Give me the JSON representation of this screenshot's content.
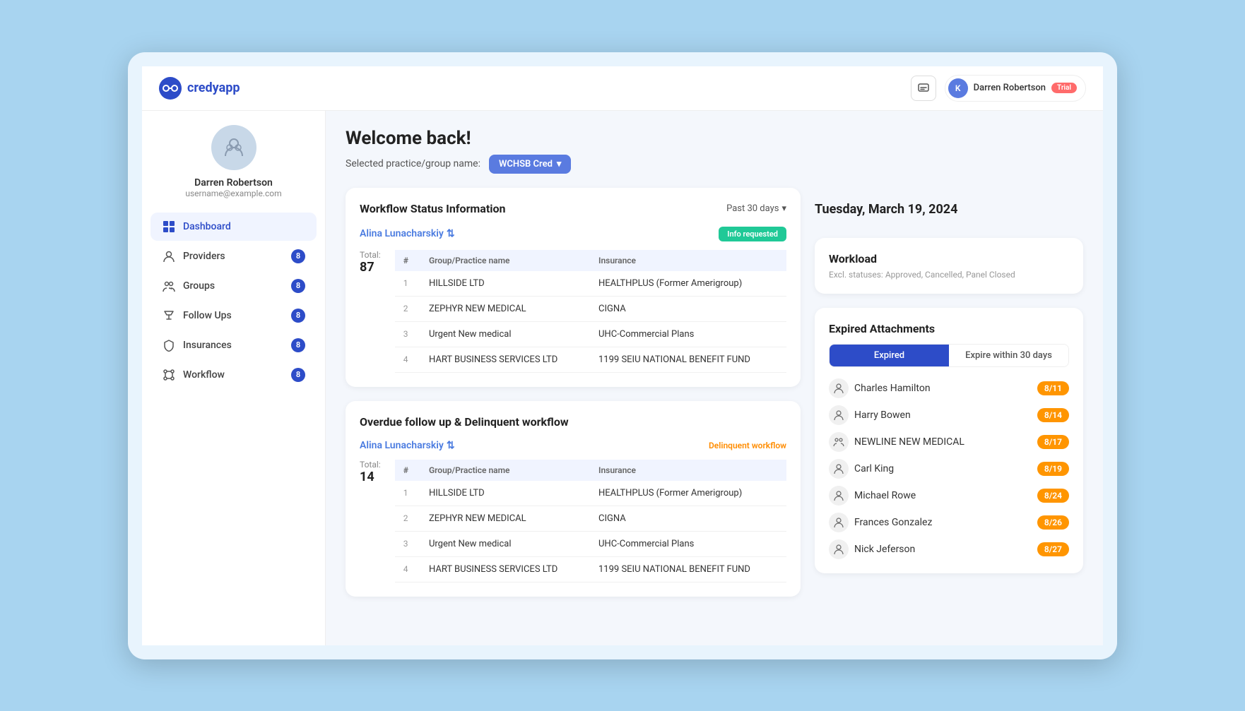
{
  "app": {
    "name": "credyapp",
    "logo_text": "credyapp"
  },
  "header": {
    "notification_label": "notifications",
    "user": {
      "initial": "K",
      "name": "Darren Robertson",
      "trial_badge": "Trial"
    }
  },
  "sidebar": {
    "user": {
      "name": "Darren Robertson",
      "email": "username@example.com"
    },
    "nav_items": [
      {
        "id": "dashboard",
        "label": "Dashboard",
        "badge": null,
        "active": true
      },
      {
        "id": "providers",
        "label": "Providers",
        "badge": "8",
        "active": false
      },
      {
        "id": "groups",
        "label": "Groups",
        "badge": "8",
        "active": false
      },
      {
        "id": "follow-ups",
        "label": "Follow Ups",
        "badge": "8",
        "active": false
      },
      {
        "id": "insurances",
        "label": "Insurances",
        "badge": "8",
        "active": false
      },
      {
        "id": "workflow",
        "label": "Workflow",
        "badge": "8",
        "active": false
      }
    ]
  },
  "main": {
    "welcome": "Welcome back!",
    "practice_label": "Selected practice/group name:",
    "practice_value": "WCHSB Cred",
    "date": "Tuesday, March 19, 2024",
    "workflow_card": {
      "title": "Workflow Status Information",
      "period": "Past 30 days",
      "provider": "Alina Lunacharskiy",
      "status_badge": "Info requested",
      "total_label": "Total:",
      "total_value": "87",
      "table": {
        "headers": [
          "#",
          "Group/Practice name",
          "Insurance"
        ],
        "rows": [
          {
            "num": "1",
            "group": "HILLSIDE LTD",
            "insurance": "HEALTHPLUS (Former Amerigroup)"
          },
          {
            "num": "2",
            "group": "ZEPHYR NEW MEDICAL",
            "insurance": "CIGNA"
          },
          {
            "num": "3",
            "group": "Urgent New medical",
            "insurance": "UHC-Commercial Plans"
          },
          {
            "num": "4",
            "group": "HART BUSINESS SERVICES LTD",
            "insurance": "1199 SEIU NATIONAL BENEFIT FUND"
          }
        ]
      }
    },
    "overdue_card": {
      "title": "Overdue follow up & Delinquent workflow",
      "provider": "Alina Lunacharskiy",
      "delinquent_label": "Delinquent workflow",
      "total_label": "Total:",
      "total_value": "14",
      "table": {
        "headers": [
          "#",
          "Group/Practice name",
          "Insurance"
        ],
        "rows": [
          {
            "num": "1",
            "group": "HILLSIDE LTD",
            "insurance": "HEALTHPLUS (Former Amerigroup)"
          },
          {
            "num": "2",
            "group": "ZEPHYR NEW MEDICAL",
            "insurance": "CIGNA"
          },
          {
            "num": "3",
            "group": "Urgent New medical",
            "insurance": "UHC-Commercial Plans"
          },
          {
            "num": "4",
            "group": "HART BUSINESS SERVICES LTD",
            "insurance": "1199 SEIU NATIONAL BENEFIT FUND"
          }
        ]
      }
    },
    "workload": {
      "title": "Workload",
      "subtitle": "Excl. statuses: Approved, Cancelled, Panel Closed"
    },
    "expired_attachments": {
      "title": "Expired Attachments",
      "tabs": [
        {
          "label": "Expired",
          "active": true
        },
        {
          "label": "Expire within 30 days",
          "active": false
        }
      ],
      "items": [
        {
          "name": "Charles Hamilton",
          "date": "8/11",
          "type": "person"
        },
        {
          "name": "Harry Bowen",
          "date": "8/14",
          "type": "person"
        },
        {
          "name": "NEWLINE NEW MEDICAL",
          "date": "8/17",
          "type": "group"
        },
        {
          "name": "Carl King",
          "date": "8/19",
          "type": "person"
        },
        {
          "name": "Michael Rowe",
          "date": "8/24",
          "type": "person"
        },
        {
          "name": "Frances Gonzalez",
          "date": "8/26",
          "type": "person"
        },
        {
          "name": "Nick Jeferson",
          "date": "8/27",
          "type": "person"
        }
      ]
    }
  }
}
